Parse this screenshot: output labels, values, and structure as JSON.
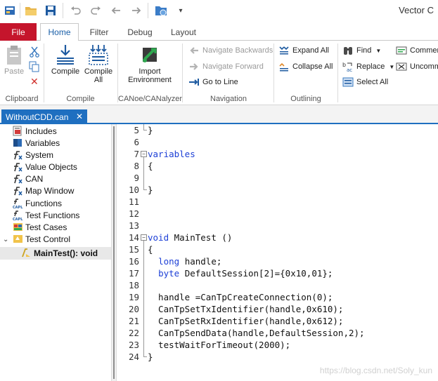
{
  "app_title": "Vector C",
  "tabs": {
    "file": "File",
    "home": "Home",
    "filter": "Filter",
    "debug": "Debug",
    "layout": "Layout"
  },
  "ribbon": {
    "clipboard": {
      "label": "Clipboard",
      "paste": "Paste"
    },
    "compile": {
      "label": "Compile",
      "compile": "Compile",
      "compile_all_1": "Compile",
      "compile_all_2": "All"
    },
    "canoe": {
      "label": "CANoe/CANalyzer",
      "import_1": "Import",
      "import_2": "Environment"
    },
    "navigation": {
      "label": "Navigation",
      "back": "Navigate Backwards",
      "forward": "Navigate Forward",
      "goto": "Go to Line"
    },
    "outlining": {
      "label": "Outlining",
      "expand": "Expand All",
      "collapse": "Collapse All"
    },
    "find": {
      "find": "Find",
      "replace": "Replace",
      "select_all": "Select All",
      "comment": "Commer",
      "uncomment": "Uncomm"
    }
  },
  "doc_tab": {
    "title": "WithoutCDD.can",
    "close": "✕"
  },
  "tree": [
    {
      "label": "Includes",
      "icon": "includes-icon"
    },
    {
      "label": "Variables",
      "icon": "variables-icon"
    },
    {
      "label": "System",
      "icon": "fx-icon"
    },
    {
      "label": "Value Objects",
      "icon": "fx-icon"
    },
    {
      "label": "CAN",
      "icon": "fx-icon"
    },
    {
      "label": "Map Window",
      "icon": "fx-icon"
    },
    {
      "label": "Functions",
      "icon": "capl-icon"
    },
    {
      "label": "Test Functions",
      "icon": "capl-icon"
    },
    {
      "label": "Test Cases",
      "icon": "test-cases-icon"
    },
    {
      "label": "Test Control",
      "icon": "test-control-icon"
    },
    {
      "label": "MainTest(): void",
      "icon": "main-test-icon"
    }
  ],
  "code_lines": [
    {
      "n": "5",
      "t": "}"
    },
    {
      "n": "6",
      "t": ""
    },
    {
      "n": "7",
      "t": "variables"
    },
    {
      "n": "8",
      "t": "{"
    },
    {
      "n": "9",
      "t": ""
    },
    {
      "n": "10",
      "t": "}"
    },
    {
      "n": "11",
      "t": ""
    },
    {
      "n": "12",
      "t": ""
    },
    {
      "n": "13",
      "t": ""
    },
    {
      "n": "14",
      "t": "void MainTest ()"
    },
    {
      "n": "15",
      "t": "{"
    },
    {
      "n": "16",
      "t": "  long handle;"
    },
    {
      "n": "17",
      "t": "  byte DefaultSession[2]={0x10,01};"
    },
    {
      "n": "18",
      "t": ""
    },
    {
      "n": "19",
      "t": "  handle =CanTpCreateConnection(0);"
    },
    {
      "n": "20",
      "t": "  CanTpSetTxIdentifier(handle,0x610);"
    },
    {
      "n": "21",
      "t": "  CanTpSetRxIdentifier(handle,0x612);"
    },
    {
      "n": "22",
      "t": "  CanTpSendData(handle,DefaultSession,2);"
    },
    {
      "n": "23",
      "t": "  testWaitForTimeout(2000);"
    },
    {
      "n": "24",
      "t": "}"
    }
  ],
  "watermark": "https://blog.csdn.net/Soly_kun",
  "colors": {
    "file_tab": "#c5152c",
    "doc_tab": "#1f6fc0",
    "keyword": "#1c3fd6"
  }
}
